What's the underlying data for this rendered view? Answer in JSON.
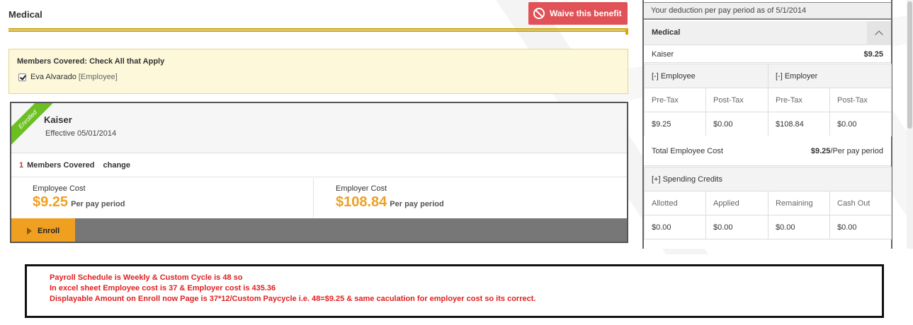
{
  "section": {
    "title": "Medical",
    "waive_label": "Waive this benefit"
  },
  "members": {
    "title": "Members Covered: Check All that Apply",
    "member_name": "Eva Alvarado",
    "member_role": "[Employee]",
    "checked": true
  },
  "plan": {
    "ribbon": "Enrolled",
    "name": "Kaiser",
    "effective": "Effective 05/01/2014",
    "members_count": "1",
    "members_label": "Members Covered",
    "change_label": "change",
    "employee_cost_label": "Employee Cost",
    "employee_cost": "$9.25",
    "employer_cost_label": "Employer Cost",
    "employer_cost": "$108.84",
    "per_pay_period": "Per pay period",
    "enroll_label": "Enroll"
  },
  "summary": {
    "header": "Your deduction per pay period as of 5/1/2014",
    "section": "Medical",
    "plan_name": "Kaiser",
    "plan_amount": "$9.25",
    "employee_header": "[-] Employee",
    "employer_header": "[-] Employer",
    "pre_tax": "Pre-Tax",
    "post_tax": "Post-Tax",
    "values": [
      "$9.25",
      "$0.00",
      "$108.84",
      "$0.00"
    ],
    "total_label": "Total Employee Cost",
    "total_value": "$9.25",
    "total_suffix": "/Per pay period",
    "credits_header": "[+] Spending Credits",
    "credit_cols": [
      "Allotted",
      "Applied",
      "Remaining",
      "Cash Out"
    ],
    "credit_values": [
      "$0.00",
      "$0.00",
      "$0.00",
      "$0.00"
    ]
  },
  "note": {
    "lines": [
      "Payroll Schedule is Weekly & Custom Cycle is 48 so",
      "In excel sheet Employee cost is 37 & Employer cost is 435.36",
      "Displayable Amount on Enroll now Page is 37*12/Custom Paycycle i.e. 48=$9.25 & same caculation for employer cost so its correct."
    ]
  },
  "colors": {
    "accent_orange": "#f0a020",
    "waive_red": "#e05257",
    "ribbon_green": "#6cbf23",
    "note_red": "#e02020"
  }
}
